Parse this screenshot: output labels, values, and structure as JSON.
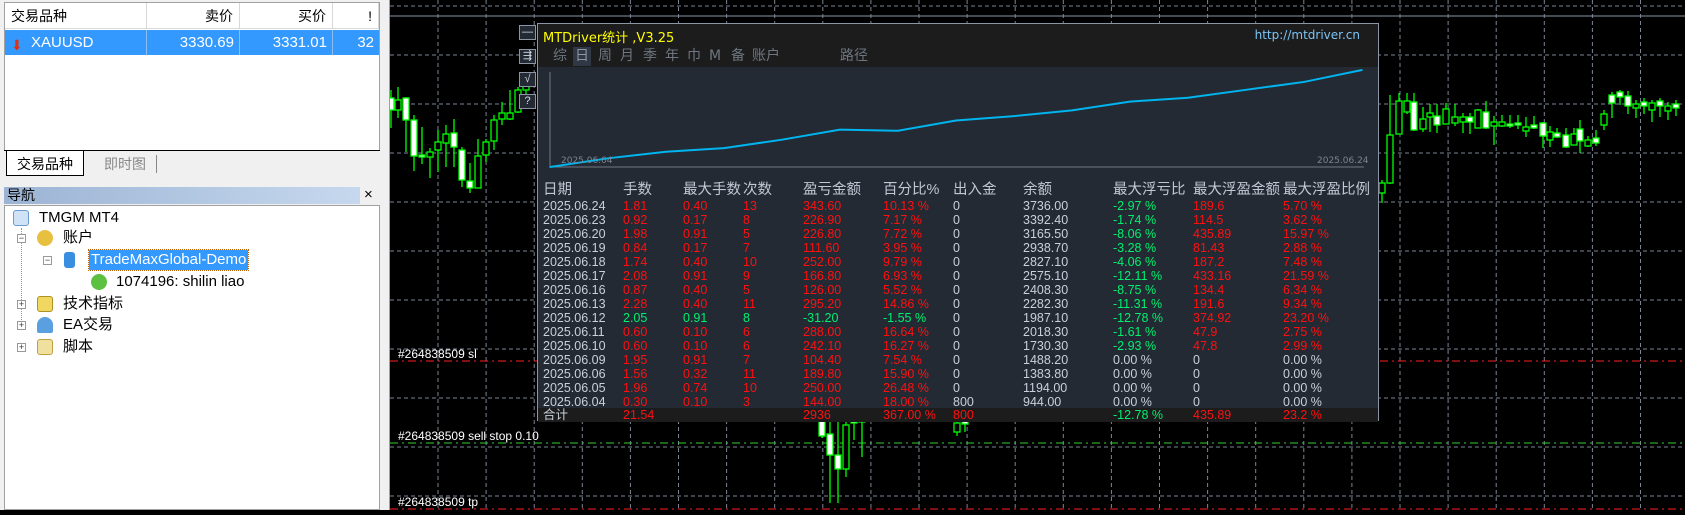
{
  "market_watch": {
    "columns": [
      "交易品种",
      "卖价",
      "买价",
      "!"
    ],
    "rows": [
      {
        "symbol": "XAUUSD",
        "bid": "3330.69",
        "ask": "3331.01",
        "spread": "32",
        "direction": "down"
      }
    ],
    "tabs": [
      "交易品种",
      "即时图"
    ],
    "active_tab": "交易品种"
  },
  "navigator": {
    "title": "导航",
    "close": "×",
    "items": [
      {
        "label": "TMGM MT4",
        "icon": "terminal-icon"
      },
      {
        "label": "账户",
        "icon": "accounts-icon",
        "expanded": true
      },
      {
        "label": "TradeMaxGlobal-Demo",
        "icon": "server-icon",
        "selected": true
      },
      {
        "label": "1074196: shilin liao",
        "icon": "user-icon"
      },
      {
        "label": "技术指标",
        "icon": "indicator-icon"
      },
      {
        "label": "EA交易",
        "icon": "expert-icon"
      },
      {
        "label": "脚本",
        "icon": "script-icon"
      }
    ]
  },
  "chart": {
    "order_lines": [
      {
        "label": "#264838509 sl",
        "color": "#ff2020"
      },
      {
        "label": "#264838509 sell stop 0.10",
        "color": "#30d030"
      },
      {
        "label": "#264838509 tp",
        "color": "#ff2020"
      }
    ],
    "side_buttons": [
      "—",
      "⇶",
      "√",
      "?"
    ]
  },
  "panel": {
    "title": "MTDriver统计 ,V3.25",
    "url": "http://mtdriver.cn",
    "tabs": [
      "综",
      "日",
      "周",
      "月",
      "季",
      "年",
      "巾",
      "M",
      "备",
      "账户",
      "路径"
    ],
    "active_tab": "日",
    "equity": {
      "start_label": "2025.06.04",
      "end_label": "2025.06.24",
      "line_color": "#00b4f0"
    },
    "columns": [
      "日期",
      "手数",
      "最大手数",
      "次数",
      "盈亏金额",
      "百分比%",
      "出入金",
      "余额",
      "最大浮亏比",
      "最大浮盈金额",
      "最大浮盈比例"
    ],
    "rows": [
      [
        "2025.06.24",
        "1.81",
        "0.40",
        "13",
        "343.60",
        "10.13 %",
        "0",
        "3736.00",
        "-2.97 %",
        "189.6",
        "5.70 %"
      ],
      [
        "2025.06.23",
        "0.92",
        "0.17",
        "8",
        "226.90",
        "7.17 %",
        "0",
        "3392.40",
        "-1.74 %",
        "114.5",
        "3.62 %"
      ],
      [
        "2025.06.20",
        "1.98",
        "0.91",
        "5",
        "226.80",
        "7.72 %",
        "0",
        "3165.50",
        "-8.06 %",
        "435.89",
        "15.97 %"
      ],
      [
        "2025.06.19",
        "0.84",
        "0.17",
        "7",
        "111.60",
        "3.95 %",
        "0",
        "2938.70",
        "-3.28 %",
        "81.43",
        "2.88 %"
      ],
      [
        "2025.06.18",
        "1.74",
        "0.40",
        "10",
        "252.00",
        "9.79 %",
        "0",
        "2827.10",
        "-4.06 %",
        "187.2",
        "7.48 %"
      ],
      [
        "2025.06.17",
        "2.08",
        "0.91",
        "9",
        "166.80",
        "6.93 %",
        "0",
        "2575.10",
        "-12.11 %",
        "433.16",
        "21.59 %"
      ],
      [
        "2025.06.16",
        "0.87",
        "0.40",
        "5",
        "126.00",
        "5.52 %",
        "0",
        "2408.30",
        "-8.75 %",
        "134.4",
        "6.34 %"
      ],
      [
        "2025.06.13",
        "2.28",
        "0.40",
        "11",
        "295.20",
        "14.86 %",
        "0",
        "2282.30",
        "-11.31 %",
        "191.6",
        "9.34 %"
      ],
      [
        "2025.06.12",
        "2.05",
        "0.91",
        "8",
        "-31.20",
        "-1.55 %",
        "0",
        "1987.10",
        "-12.78 %",
        "374.92",
        "23.20 %"
      ],
      [
        "2025.06.11",
        "0.60",
        "0.10",
        "6",
        "288.00",
        "16.64 %",
        "0",
        "2018.30",
        "-1.61 %",
        "47.9",
        "2.75 %"
      ],
      [
        "2025.06.10",
        "0.60",
        "0.10",
        "6",
        "242.10",
        "16.27 %",
        "0",
        "1730.30",
        "-2.93 %",
        "47.8",
        "2.99 %"
      ],
      [
        "2025.06.09",
        "1.95",
        "0.91",
        "7",
        "104.40",
        "7.54 %",
        "0",
        "1488.20",
        "0.00 %",
        "0",
        "0.00 %"
      ],
      [
        "2025.06.06",
        "1.56",
        "0.32",
        "11",
        "189.80",
        "15.90 %",
        "0",
        "1383.80",
        "0.00 %",
        "0",
        "0.00 %"
      ],
      [
        "2025.06.05",
        "1.96",
        "0.74",
        "10",
        "250.00",
        "26.48 %",
        "0",
        "1194.00",
        "0.00 %",
        "0",
        "0.00 %"
      ],
      [
        "2025.06.04",
        "0.30",
        "0.10",
        "3",
        "144.00",
        "18.00 %",
        "800",
        "944.00",
        "0.00 %",
        "0",
        "0.00 %"
      ]
    ],
    "total": [
      "合计",
      "21.54",
      "",
      "",
      "2936",
      "367.00 %",
      "800",
      "",
      "-12.78 %",
      "435.89",
      "23.2 %"
    ],
    "colors": {
      "profit": "#ff1010",
      "loss": "#00f070",
      "neutral": "#c8d0dc"
    }
  }
}
